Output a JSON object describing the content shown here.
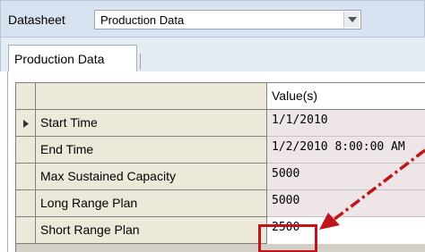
{
  "datasheet": {
    "label": "Datasheet",
    "selected_value": "Production Data"
  },
  "tabs": [
    {
      "label": "Production Data"
    }
  ],
  "grid": {
    "value_header": "Value(s)",
    "rows": [
      {
        "name": "Start Time",
        "value": "1/1/2010",
        "current": true
      },
      {
        "name": "End Time",
        "value": "1/2/2010 8:00:00 AM"
      },
      {
        "name": "Max Sustained Capacity",
        "value": "5000"
      },
      {
        "name": "Long Range Plan",
        "value": "5000"
      },
      {
        "name": "Short Range Plan",
        "value": "2500",
        "highlighted": true
      }
    ]
  },
  "colors": {
    "highlight": "#c0141a",
    "arrow": "#c0141a",
    "value_cell_bg": "#ede5e6",
    "header_bar_bg": "#d7e3f1"
  },
  "icons": {
    "dropdown": "chevron-down-icon",
    "row_indicator": "triangle-right-icon",
    "annotation": "dashed-arrow-icon"
  }
}
